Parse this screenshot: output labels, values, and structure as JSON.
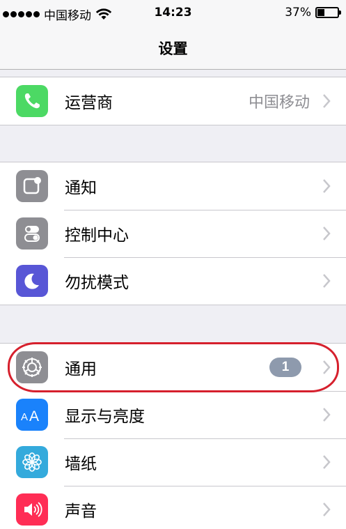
{
  "status_bar": {
    "carrier": "中国移动",
    "time": "14:23",
    "battery": "37%",
    "battery_level": 0.37
  },
  "nav": {
    "title": "设置"
  },
  "groups": [
    {
      "rows": [
        {
          "label": "运营商",
          "detail": "中国移动",
          "icon": "phone-icon",
          "color": "#4cd964"
        }
      ]
    },
    {
      "rows": [
        {
          "label": "通知",
          "icon": "notifications-icon",
          "color": "#8e8e93"
        },
        {
          "label": "控制中心",
          "icon": "control-center-icon",
          "color": "#8e8e93"
        },
        {
          "label": "勿扰模式",
          "icon": "moon-icon",
          "color": "#5856d6"
        }
      ]
    },
    {
      "rows": [
        {
          "label": "通用",
          "badge": "1",
          "icon": "gear-icon",
          "color": "#8e8e93"
        },
        {
          "label": "显示与亮度",
          "icon": "display-brightness-icon",
          "color": "#1a82fb"
        },
        {
          "label": "墙纸",
          "icon": "wallpaper-flower-icon",
          "color": "#34aadc"
        },
        {
          "label": "声音",
          "icon": "speaker-icon",
          "color": "#ff2d55"
        }
      ]
    }
  ],
  "annotation": {
    "color": "#d6202d",
    "target": "通用"
  }
}
